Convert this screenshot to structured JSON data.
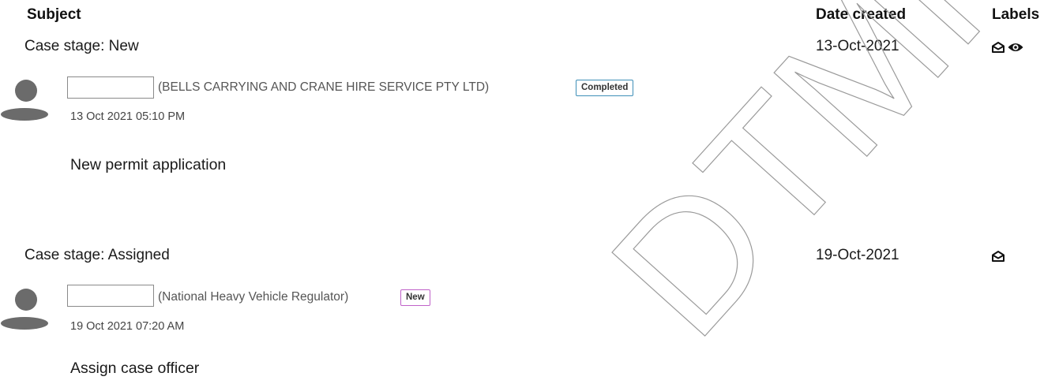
{
  "table": {
    "headers": {
      "subject": "Subject",
      "date_created": "Date created",
      "labels": "Labels"
    }
  },
  "entries": [
    {
      "stage": "Case stage: New",
      "date_created": "13-Oct-2021",
      "labels": [
        "envelope-open-icon",
        "eye-icon"
      ],
      "org": "(BELLS CARRYING AND CRANE HIRE SERVICE PTY LTD)",
      "status": "Completed",
      "status_color": "#3f8fb8",
      "timestamp": "13 Oct 2021 05:10 PM",
      "message": "New permit application"
    },
    {
      "stage": "Case stage: Assigned",
      "date_created": "19-Oct-2021",
      "labels": [
        "envelope-open-icon"
      ],
      "org": "(National Heavy Vehicle Regulator)",
      "status": "New",
      "status_color": "#c062c9",
      "timestamp": "19 Oct 2021 07:20 AM",
      "message": "Assign case officer"
    }
  ],
  "watermark": {
    "text": "DTMR",
    "color": "#9a9a9a"
  }
}
